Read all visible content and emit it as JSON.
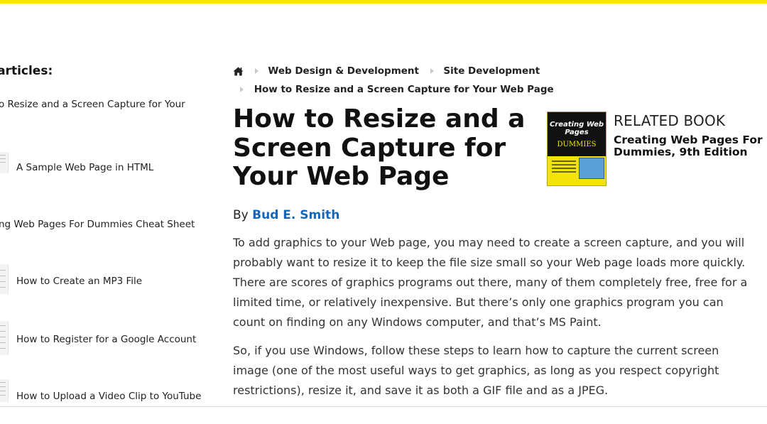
{
  "sidebar": {
    "title": "d articles:",
    "items": [
      {
        "label": "o Resize and a Screen Capture for Your"
      },
      {
        "label": "A Sample Web Page in HTML"
      },
      {
        "label": "ng Web Pages For Dummies Cheat Sheet"
      },
      {
        "label": "How to Create an MP3 File"
      },
      {
        "label": "How to Register for a Google Account"
      },
      {
        "label": "How to Upload a Video Clip to YouTube"
      }
    ]
  },
  "breadcrumb": {
    "home_icon": "home-icon",
    "items": [
      {
        "label": "Web Design & Development"
      },
      {
        "label": "Site Development"
      },
      {
        "label": "How to Resize and a Screen Capture for Your Web Page"
      }
    ]
  },
  "article": {
    "title_lines": [
      "How to Resize and a",
      "Screen Capture for",
      "Your Web Page"
    ],
    "by_label": "By",
    "author": "Bud E. Smith",
    "paragraphs": [
      "To add graphics to your Web page, you may need to create a screen capture, and you will probably want to resize it to keep the file size small so your Web page loads more quickly. There are scores of graphics programs out there, many of them completely free, free for a limited time, or relatively inexpensive. But there’s only one graphics program you can count on finding on any Windows computer, and that’s MS Paint.",
      "So, if you use Windows, follow these steps to learn how to capture the current screen image (one of the most useful ways to get graphics, as long as you respect copyright restrictions), resize it, and save it as both a GIF file and as a JPEG."
    ]
  },
  "related": {
    "label": "RELATED BOOK",
    "title": "Creating Web Pages For Dummies, 9th Edition",
    "cover": {
      "title": "Creating Web Pages",
      "brand": "DUMMIES"
    }
  },
  "colors": {
    "accent": "#ffe600",
    "link": "#1565b8"
  }
}
